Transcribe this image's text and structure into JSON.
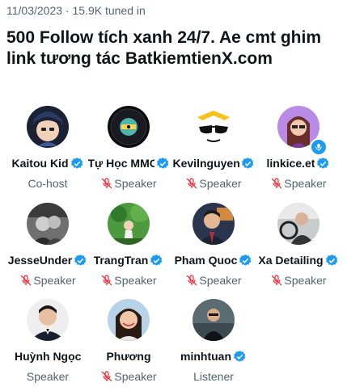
{
  "space": {
    "date": "11/03/2023",
    "separator": "·",
    "tuned_in": "15.9K tuned in",
    "title": "500 Follow tích xanh 24/7. Ae cmt ghim link tương tác BatkiemtienX.com"
  },
  "colors": {
    "verified_blue": "#1d9bf0",
    "muted_red": "#f4212e",
    "secondary_text": "#536471"
  },
  "participants": [
    {
      "name": "Kaitou Kid",
      "verified": true,
      "role": "Co-host",
      "muted": false
    },
    {
      "name": "Tự Học MMO",
      "verified": true,
      "role": "Speaker",
      "muted": true
    },
    {
      "name": "Kevilnguyen",
      "verified": true,
      "role": "Speaker",
      "muted": true
    },
    {
      "name": "linkice.et",
      "verified": true,
      "role": "Speaker",
      "muted": true,
      "mic_badge": true
    },
    {
      "name": "JesseUnder",
      "verified": true,
      "role": "Speaker",
      "muted": true
    },
    {
      "name": "TrangTran",
      "verified": true,
      "role": "Speaker",
      "muted": true
    },
    {
      "name": "Pham Quoc",
      "verified": true,
      "role": "Speaker",
      "muted": true
    },
    {
      "name": "Xa Detailing",
      "verified": true,
      "role": "Speaker",
      "muted": true
    },
    {
      "name": "Huỳnh Ngọc",
      "verified": false,
      "role": "Speaker",
      "muted": false
    },
    {
      "name": "Phương",
      "verified": false,
      "role": "Speaker",
      "muted": true
    },
    {
      "name": "minhtuan",
      "verified": true,
      "role": "Listener",
      "muted": false
    }
  ]
}
